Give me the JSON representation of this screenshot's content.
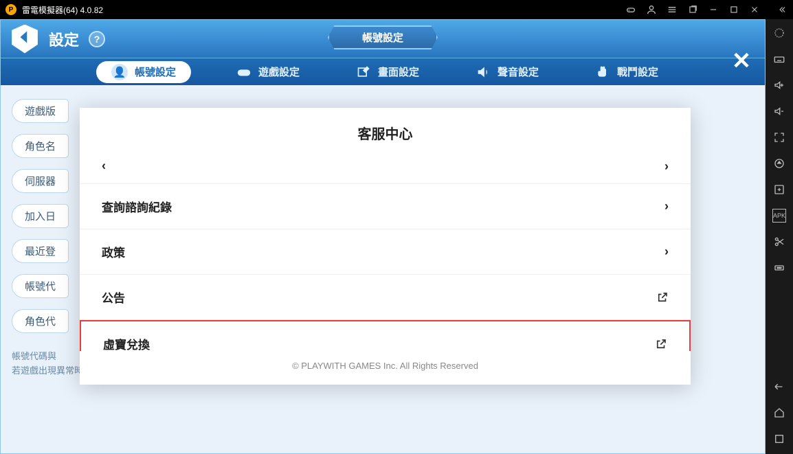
{
  "emulator": {
    "title": "雷電模擬器(64) 4.0.82"
  },
  "header": {
    "settings_label": "設定",
    "banner": "帳號設定"
  },
  "tabs": {
    "account": "帳號設定",
    "game": "遊戲設定",
    "display": "畫面設定",
    "sound": "聲音設定",
    "battle": "戰鬥設定"
  },
  "left_pills": {
    "p0": "遊戲版",
    "p1": "角色名",
    "p2": "伺服器",
    "p3": "加入日",
    "p4": "最近登",
    "p5": "帳號代",
    "p6": "角色代"
  },
  "hints": {
    "line1": "帳號代碼與",
    "line2": "若遊戲出現異常時，可迅速提供資訊給客服。"
  },
  "modal": {
    "title": "客服中心",
    "item0": "查詢諮詢紀錄",
    "item1": "政策",
    "item2": "公告",
    "item3": "虛寶兌換",
    "footer": "© PLAYWITH GAMES Inc. All Rights Reserved"
  }
}
